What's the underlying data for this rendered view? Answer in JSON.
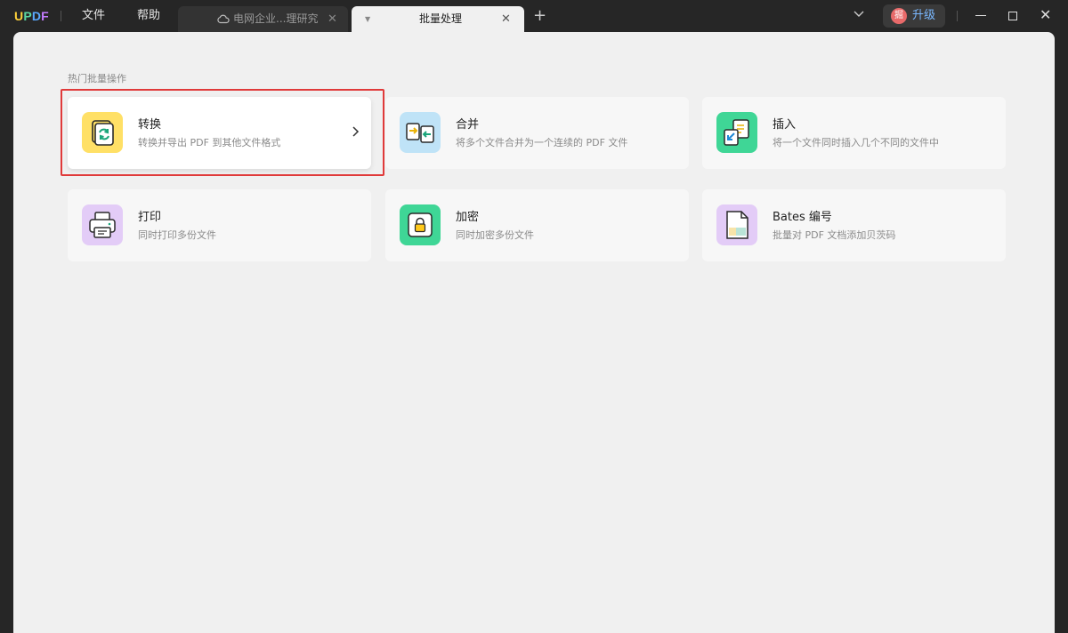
{
  "app": {
    "logo_letters": [
      "U",
      "P",
      "D",
      "F"
    ]
  },
  "menu": {
    "file": "文件",
    "help": "帮助"
  },
  "tabs": [
    {
      "label": "电网企业...理研究",
      "icon": "cloud-icon",
      "active": false
    },
    {
      "label": "批量处理",
      "active": true
    }
  ],
  "toolbar": {
    "avatar_text": "掘",
    "upgrade_label": "升级"
  },
  "section": {
    "title": "热门批量操作"
  },
  "cards": [
    {
      "title": "转换",
      "desc": "转换并导出 PDF 到其他文件格式",
      "icon": "convert-icon",
      "color": "#ffe066",
      "selected": true
    },
    {
      "title": "合并",
      "desc": "将多个文件合并为一个连续的 PDF 文件",
      "icon": "merge-icon",
      "color": "#bfe3f7"
    },
    {
      "title": "插入",
      "desc": "将一个文件同时插入几个不同的文件中",
      "icon": "insert-icon",
      "color": "#3fd696"
    },
    {
      "title": "打印",
      "desc": "同时打印多份文件",
      "icon": "print-icon",
      "color": "#e3ccf7"
    },
    {
      "title": "加密",
      "desc": "同时加密多份文件",
      "icon": "lock-icon",
      "color": "#3fd696"
    },
    {
      "title": "Bates 编号",
      "desc": "批量对 PDF 文档添加贝茨码",
      "icon": "bates-number-icon",
      "color": "#e3ccf7"
    }
  ],
  "colors": {
    "highlight": "#e03a3a",
    "background": "#262626",
    "panel": "#f0f0f0"
  }
}
